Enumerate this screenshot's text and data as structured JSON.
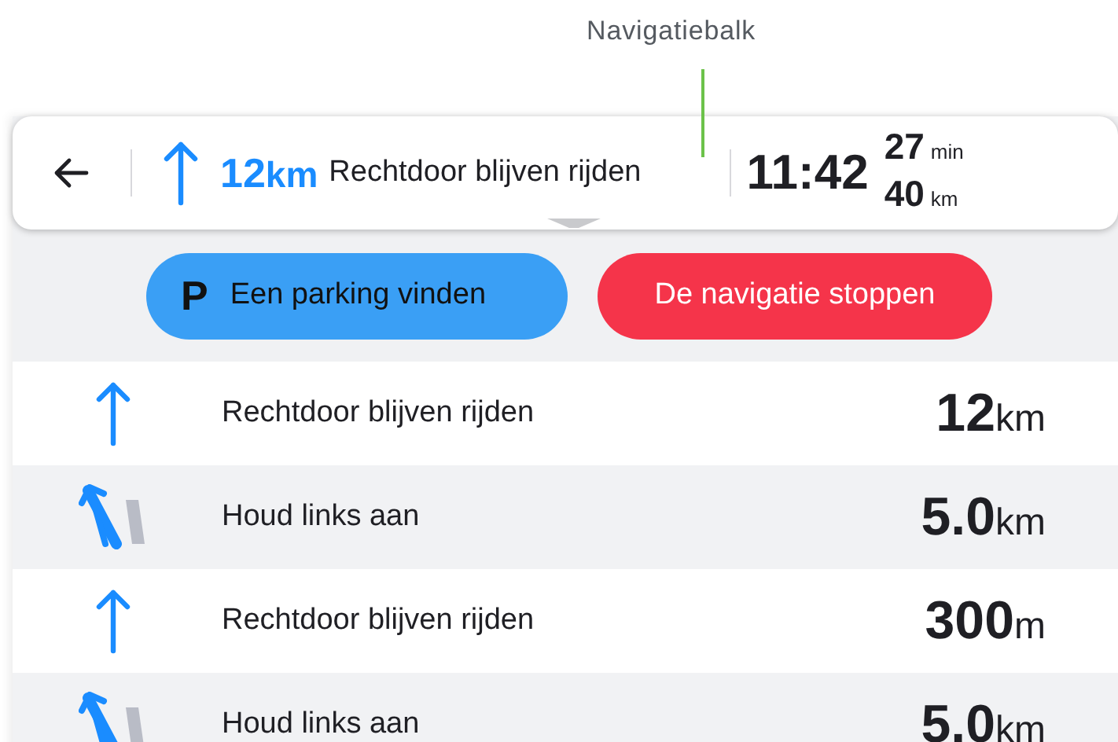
{
  "annotation": {
    "label": "Navigatiebalk"
  },
  "nav_bar": {
    "distance": "12",
    "unit": "km",
    "instruction": "Rechtdoor blijven rijden",
    "arrival_time": "11:42",
    "remaining_time": "27",
    "time_unit": "min",
    "remaining_distance": "40",
    "distance_unit": "km"
  },
  "buttons": [
    {
      "kind": "parking",
      "icon_text": "P",
      "label": "Een parking vinden"
    },
    {
      "kind": "stop",
      "label": "De navigatie stoppen"
    }
  ],
  "steps": [
    {
      "kind": "straight",
      "instruction": "Rechtdoor blijven rijden",
      "distance": "12",
      "unit": "km"
    },
    {
      "kind": "keep-left",
      "instruction": "Houd links aan",
      "distance": "5.0",
      "unit": "km"
    },
    {
      "kind": "straight",
      "instruction": "Rechtdoor blijven rijden",
      "distance": "300",
      "unit": "m"
    },
    {
      "kind": "keep-left",
      "instruction": "Houd links aan",
      "distance": "5.0",
      "unit": "km"
    }
  ]
}
